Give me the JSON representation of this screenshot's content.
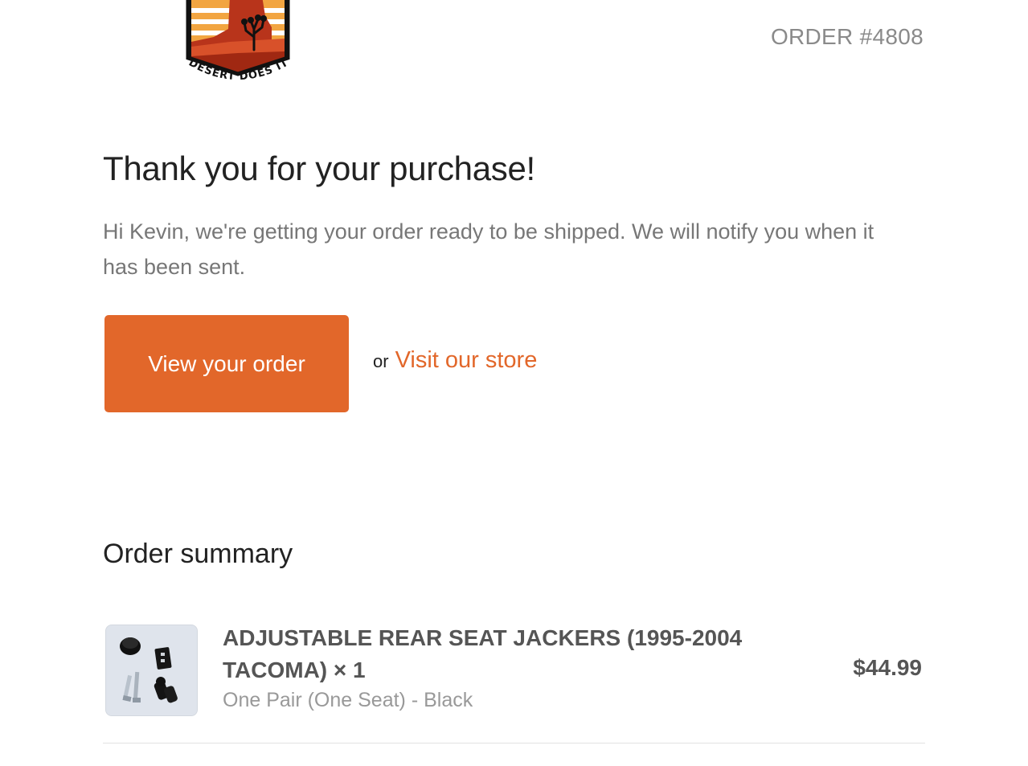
{
  "header": {
    "logo_text": "DESERT DOES IT",
    "order_number": "ORDER #4808"
  },
  "main": {
    "title": "Thank you for your purchase!",
    "message": "Hi Kevin, we're getting your order ready to be shipped. We will notify you when it has been sent.",
    "view_order_label": "View your order",
    "or_text": "or",
    "visit_store_label": "Visit our store"
  },
  "summary": {
    "title": "Order summary",
    "items": [
      {
        "name": "ADJUSTABLE REAR SEAT JACKERS (1995-2004 TACOMA) × 1",
        "variant": "One Pair (One Seat) - Black",
        "price": "$44.99",
        "thumbnail_icon": "seat-jacker-parts-image"
      }
    ]
  },
  "colors": {
    "accent": "#e2672a",
    "title": "#222222",
    "muted": "#777777"
  }
}
